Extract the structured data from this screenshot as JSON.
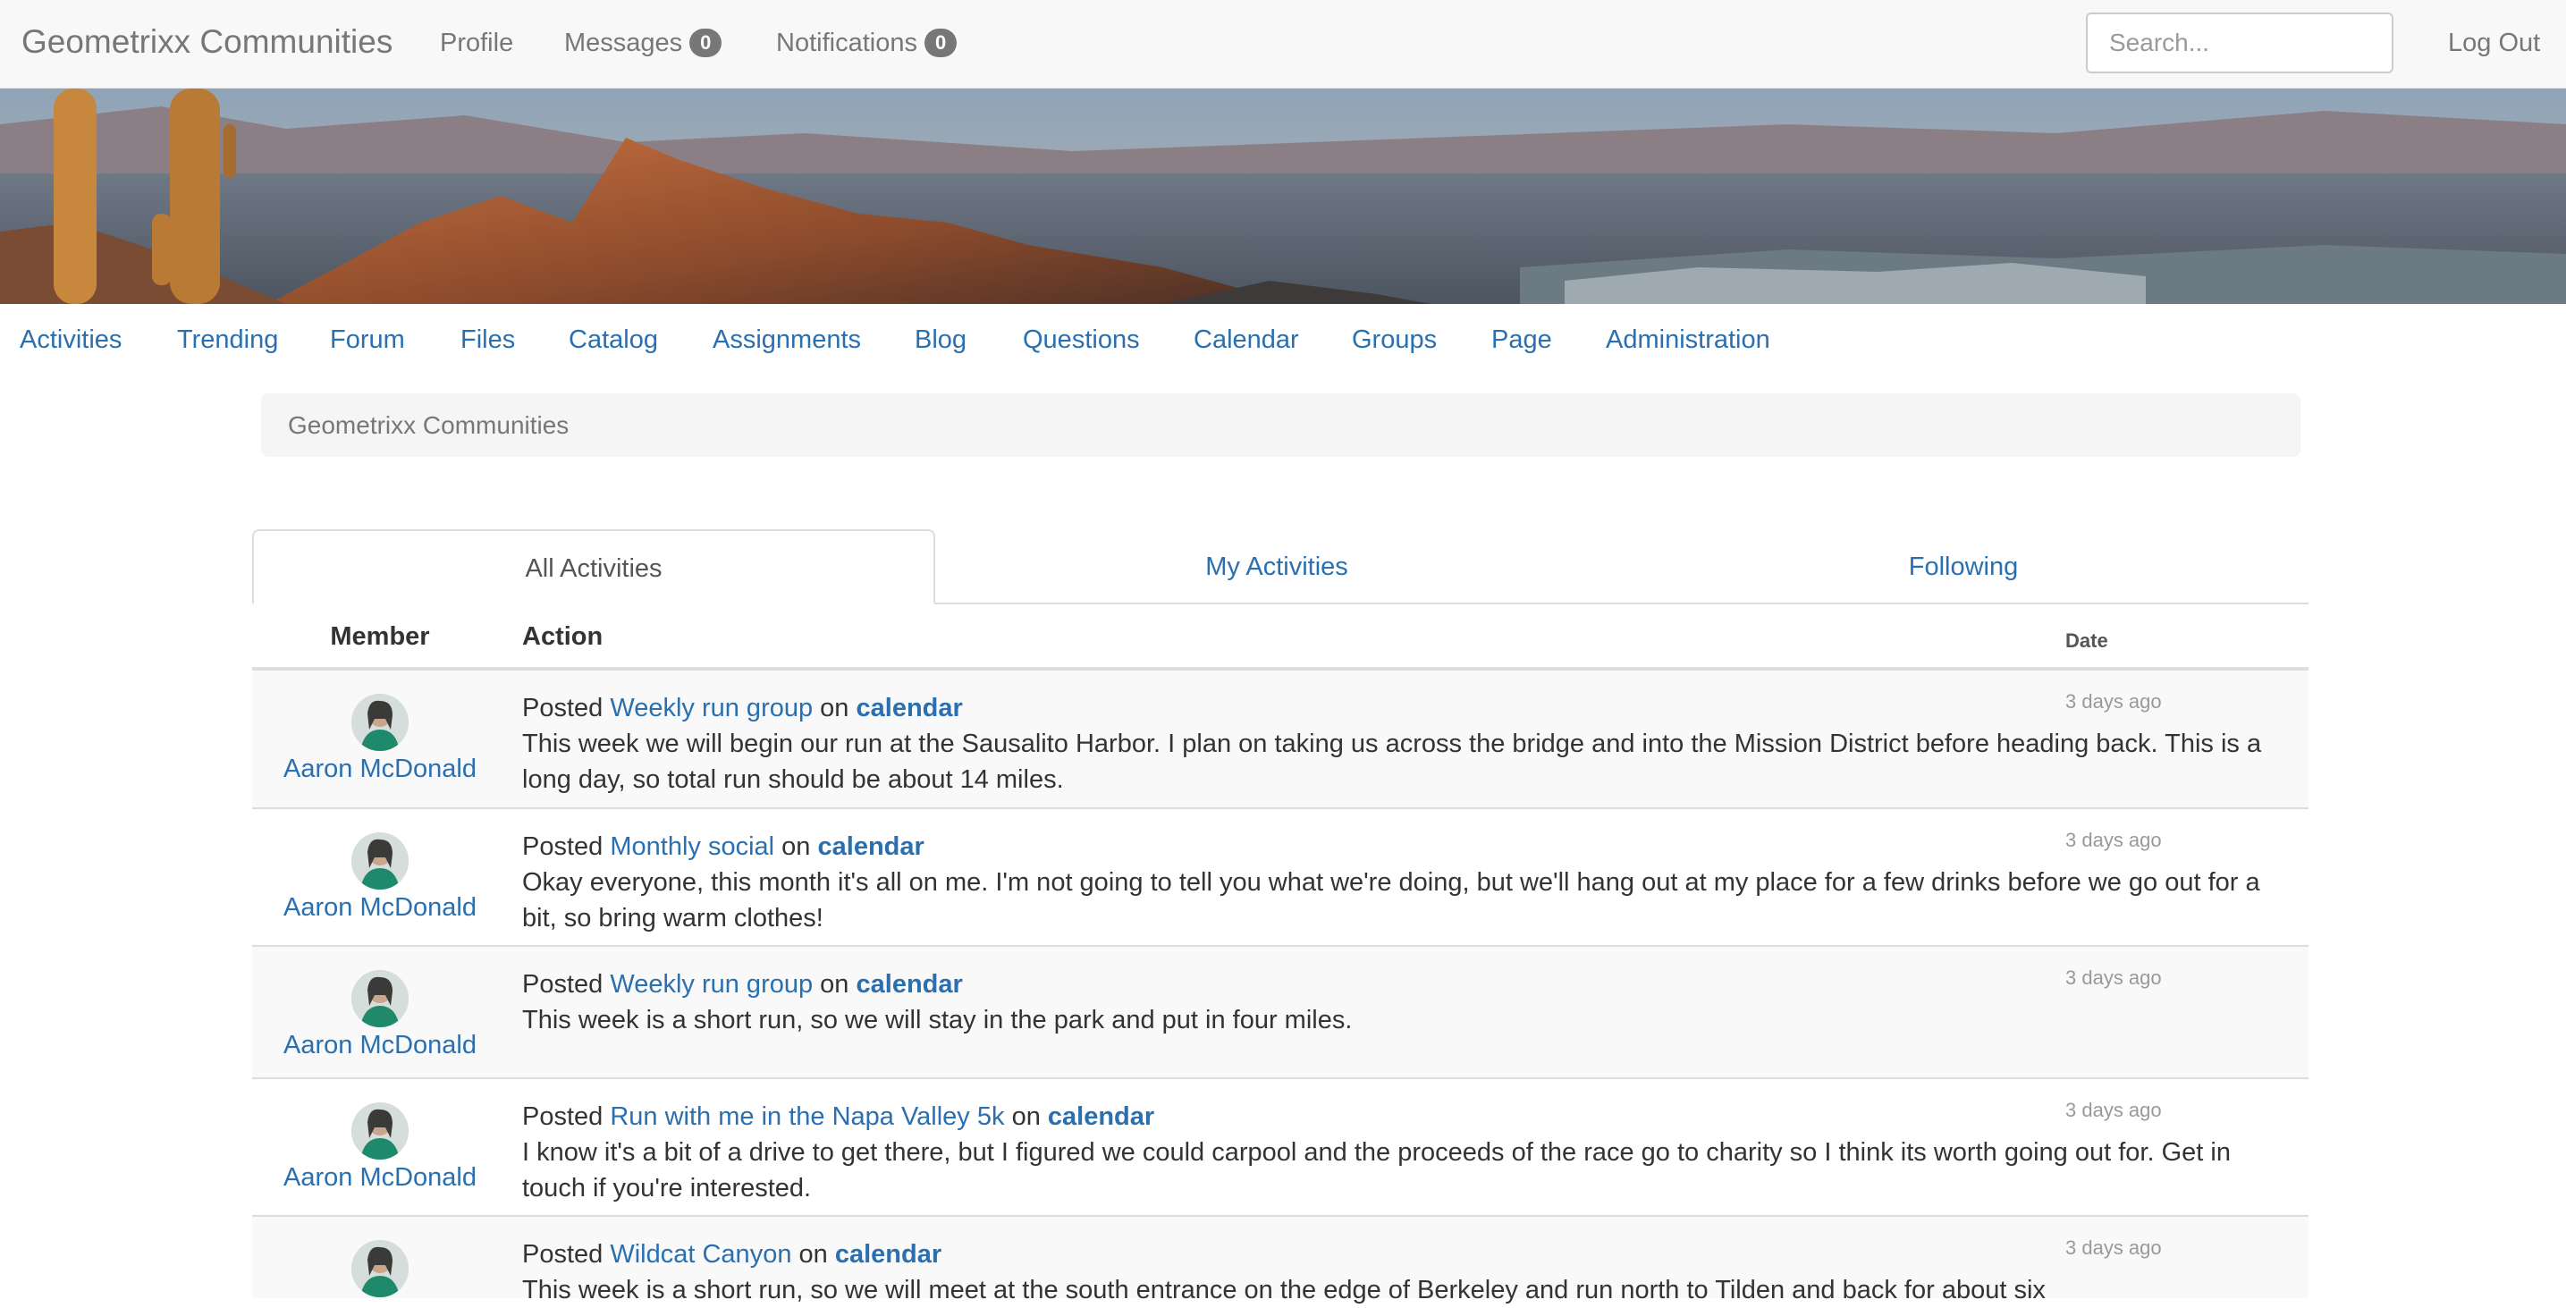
{
  "navbar": {
    "brand": "Geometrixx Communities",
    "profile": "Profile",
    "messages": {
      "label": "Messages",
      "count": "0"
    },
    "notifications": {
      "label": "Notifications",
      "count": "0"
    },
    "search_placeholder": "Search...",
    "logout": "Log Out"
  },
  "subnav": [
    "Activities",
    "Trending",
    "Forum",
    "Files",
    "Catalog",
    "Assignments",
    "Blog",
    "Questions",
    "Calendar",
    "Groups",
    "Page",
    "Administration"
  ],
  "breadcrumb": "Geometrixx Communities",
  "tabs": [
    "All Activities",
    "My Activities",
    "Following"
  ],
  "table": {
    "headers": {
      "member": "Member",
      "action": "Action",
      "date": "Date"
    },
    "rows": [
      {
        "member": "Aaron McDonald",
        "verb": "Posted",
        "item": "Weekly run group",
        "on": "on",
        "target": "calendar",
        "text": "This week we will begin our run at the Sausalito Harbor. I plan on taking us across the bridge and into the Mission District before heading back. This is a long day, so total run should be about 14 miles.",
        "date": "3 days ago"
      },
      {
        "member": "Aaron McDonald",
        "verb": "Posted",
        "item": "Monthly social",
        "on": "on",
        "target": "calendar",
        "text": "Okay everyone, this month it's all on me. I'm not going to tell you what we're doing, but we'll hang out at my place for a few drinks before we go out for a bit, so bring warm clothes!",
        "date": "3 days ago"
      },
      {
        "member": "Aaron McDonald",
        "verb": "Posted",
        "item": "Weekly run group",
        "on": "on",
        "target": "calendar",
        "text": "This week is a short run, so we will stay in the park and put in four miles.",
        "date": "3 days ago"
      },
      {
        "member": "Aaron McDonald",
        "verb": "Posted",
        "item": "Run with me in the Napa Valley 5k",
        "on": "on",
        "target": "calendar",
        "text": "I know it's a bit of a drive to get there, but I figured we could carpool and the proceeds of the race go to charity so I think its worth going out for. Get in touch if you're interested.",
        "date": "3 days ago"
      },
      {
        "member": "",
        "verb": "Posted",
        "item": "Wildcat Canyon",
        "on": "on",
        "target": "calendar",
        "text": "This week is a short run, so we will meet at the south entrance on the edge of Berkeley and run north to Tilden and back for about six",
        "date": "3 days ago"
      }
    ]
  },
  "colors": {
    "link": "#2a6fb0",
    "badge": "#777777",
    "row_stripe": "#f9f9f9"
  },
  "icons": {
    "avatar": "user-avatar-icon"
  }
}
